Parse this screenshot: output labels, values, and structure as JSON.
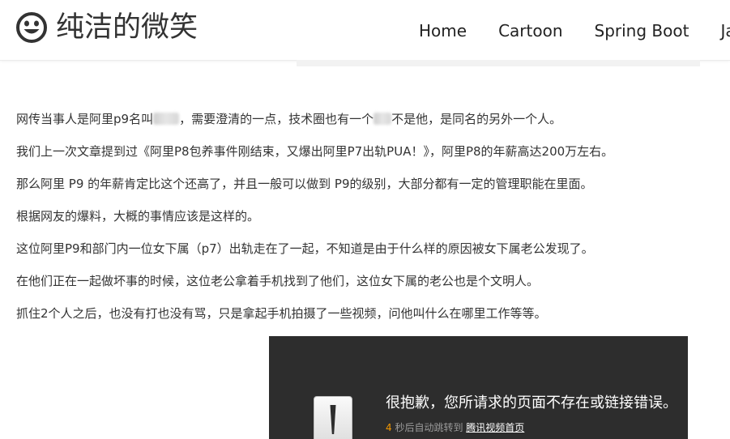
{
  "header": {
    "site_title": "纯洁的微笑",
    "logo_icon": "smiley-face-icon",
    "nav": [
      {
        "label": "Home"
      },
      {
        "label": "Cartoon"
      },
      {
        "label": "Spring Boot"
      },
      {
        "label": "Ja"
      }
    ]
  },
  "article": {
    "p1_a": "网传当事人是阿里p9名叫",
    "p1_b": "，需要澄清的一点，技术圈也有一个",
    "p1_c": "不是他，是同名的另外一个人。",
    "p2": "我们上一次文章提到过《阿里P8包养事件刚结束，又爆出阿里P7出轨PUA！》，阿里P8的年薪高达200万左右。",
    "p3": "那么阿里 P9 的年薪肯定比这个还高了，并且一般可以做到 P9的级别，大部分都有一定的管理职能在里面。",
    "p4": "根据网友的爆料，大概的事情应该是这样的。",
    "p5": "这位阿里P9和部门内一位女下属（p7）出轨走在了一起，不知道是由于什么样的原因被女下属老公发现了。",
    "p6": "在他们正在一起做坏事的时候，这位老公拿着手机找到了他们，这位女下属的老公也是个文明人。",
    "p7": "抓住2个人之后，也没有打也没有骂，只是拿起手机拍摄了一些视频，问他叫什么在哪里工作等等。"
  },
  "video_error": {
    "icon": "exclamation-warning-icon",
    "title": "很抱歉，您所请求的页面不存在或链接错误。",
    "countdown": "4",
    "redirect_text": " 秒后自动跳转到 ",
    "link_label": "腾讯视频首页"
  },
  "colors": {
    "countdown": "#f39800",
    "video_bg": "#2d2d2d"
  }
}
